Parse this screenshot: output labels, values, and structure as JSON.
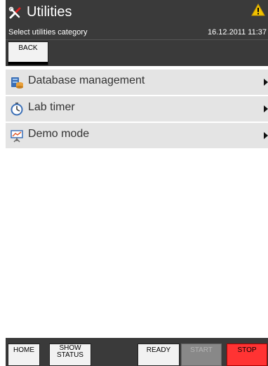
{
  "header": {
    "title": "Utilities",
    "title_icon": "tools-icon",
    "subtitle": "Select utilities category",
    "datetime": "16.12.2011 11:37",
    "warning_icon": "warning-icon"
  },
  "toolbar": {
    "back_label": "BACK"
  },
  "menu": {
    "items": [
      {
        "label": "Database management",
        "icon": "database-icon"
      },
      {
        "label": "Lab timer",
        "icon": "stopwatch-icon"
      },
      {
        "label": "Demo mode",
        "icon": "presentation-icon"
      }
    ]
  },
  "footer": {
    "home_label": "HOME",
    "status_line1": "SHOW",
    "status_line2": "STATUS",
    "ready_label": "READY",
    "start_label": "START",
    "stop_label": "STOP"
  },
  "colors": {
    "header_bg": "#3a3a3a",
    "list_item_bg": "#e4e4e4",
    "stop_bg": "#ff3333",
    "start_disabled_bg": "#888888",
    "warning": "#f2c200"
  }
}
